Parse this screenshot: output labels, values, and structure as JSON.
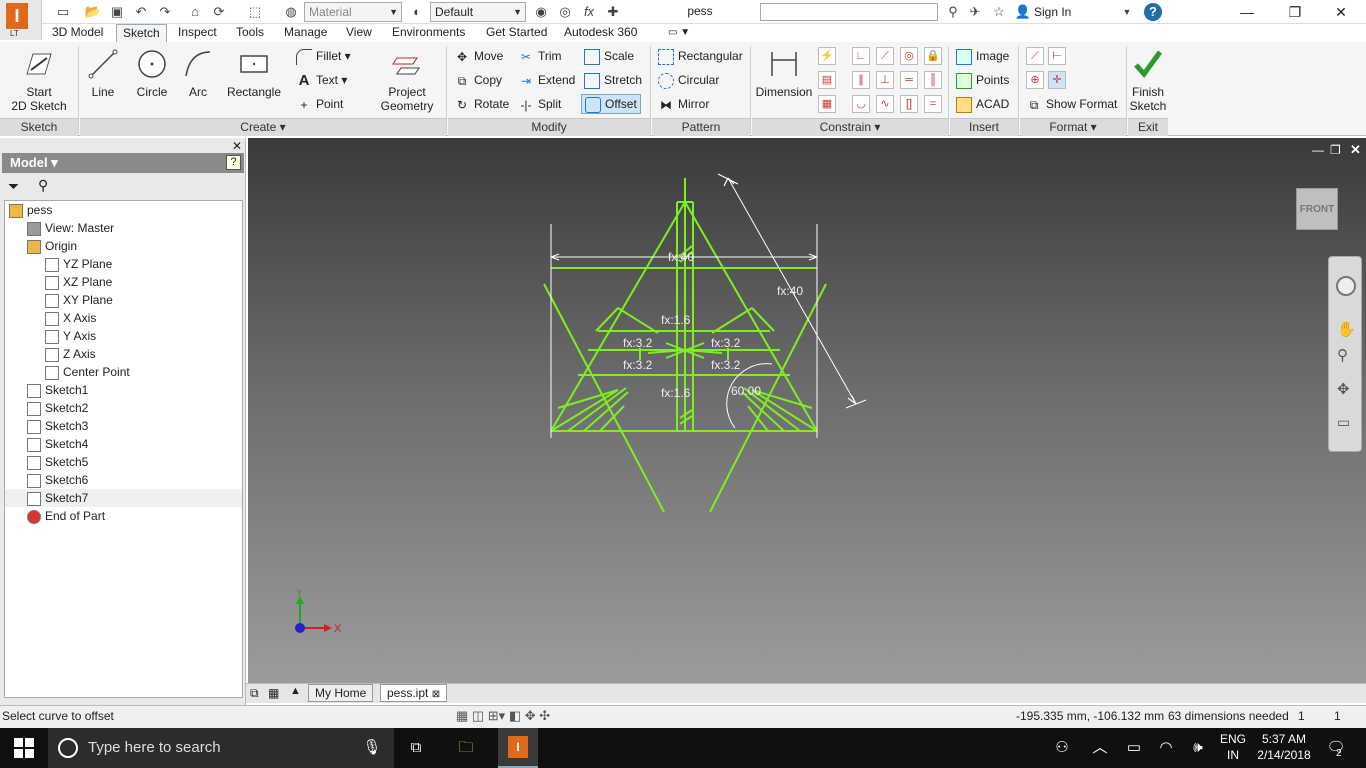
{
  "app": {
    "logo_letter": "I",
    "logo_sub": "LT"
  },
  "titlebar": {
    "material": "Material",
    "appearance": "Default",
    "document": "pess",
    "signin": "Sign In"
  },
  "tabs": [
    "3D Model",
    "Sketch",
    "Inspect",
    "Tools",
    "Manage",
    "View",
    "Environments",
    "Get Started",
    "Autodesk 360"
  ],
  "active_tab": "Sketch",
  "ribbon": {
    "sketch": {
      "start": "Start",
      "start2": "2D Sketch",
      "panel": "Sketch"
    },
    "create": {
      "line": "Line",
      "circle": "Circle",
      "arc": "Arc",
      "rectangle": "Rectangle",
      "fillet": "Fillet",
      "text": "Text",
      "point": "Point",
      "project": "Project",
      "project2": "Geometry",
      "panel": "Create"
    },
    "modify": {
      "move": "Move",
      "trim": "Trim",
      "scale": "Scale",
      "copy": "Copy",
      "extend": "Extend",
      "stretch": "Stretch",
      "rotate": "Rotate",
      "split": "Split",
      "offset": "Offset",
      "panel": "Modify"
    },
    "pattern": {
      "rectangular": "Rectangular",
      "circular": "Circular",
      "mirror": "Mirror",
      "panel": "Pattern"
    },
    "constrain": {
      "dimension": "Dimension",
      "panel": "Constrain"
    },
    "insert": {
      "image": "Image",
      "points": "Points",
      "acad": "ACAD",
      "panel": "Insert"
    },
    "format": {
      "show_format": "Show Format",
      "panel": "Format"
    },
    "exit": {
      "finish": "Finish",
      "finish2": "Sketch",
      "panel": "Exit"
    }
  },
  "browser": {
    "title": "Model",
    "nodes": [
      {
        "label": "pess",
        "indent": 0
      },
      {
        "label": "View: Master",
        "indent": 1
      },
      {
        "label": "Origin",
        "indent": 1
      },
      {
        "label": "YZ Plane",
        "indent": 2
      },
      {
        "label": "XZ Plane",
        "indent": 2
      },
      {
        "label": "XY Plane",
        "indent": 2
      },
      {
        "label": "X Axis",
        "indent": 2
      },
      {
        "label": "Y Axis",
        "indent": 2
      },
      {
        "label": "Z Axis",
        "indent": 2
      },
      {
        "label": "Center Point",
        "indent": 2
      },
      {
        "label": "Sketch1",
        "indent": 1
      },
      {
        "label": "Sketch2",
        "indent": 1
      },
      {
        "label": "Sketch3",
        "indent": 1
      },
      {
        "label": "Sketch4",
        "indent": 1
      },
      {
        "label": "Sketch5",
        "indent": 1
      },
      {
        "label": "Sketch6",
        "indent": 1
      },
      {
        "label": "Sketch7",
        "indent": 1
      },
      {
        "label": "End of Part",
        "indent": 1
      }
    ]
  },
  "viewport": {
    "viewcube": "FRONT",
    "dims": {
      "d_top": "fx:40",
      "d_slant": "fx:40",
      "d_16a": "fx:1.6",
      "d_16b": "fx:1.6",
      "d_32a": "fx:3.2",
      "d_32b": "fx:3.2",
      "d_32c": "fx:3.2",
      "d_32d": "fx:3.2",
      "d_angle": "60.00"
    },
    "axis_x": "X",
    "axis_y": "Y",
    "sketch_color": "#7cf01e"
  },
  "doctabs": {
    "home": "My Home",
    "file": "pess.ipt"
  },
  "status": {
    "prompt": "Select curve to offset",
    "coords": "-195.335 mm, -106.132 mm",
    "dims_needed": "63 dimensions needed",
    "n1": "1",
    "n2": "1"
  },
  "taskbar": {
    "search": "Type here to search",
    "lang1": "ENG",
    "lang2": "IN",
    "time": "5:37 AM",
    "date": "2/14/2018",
    "notif": "2"
  }
}
